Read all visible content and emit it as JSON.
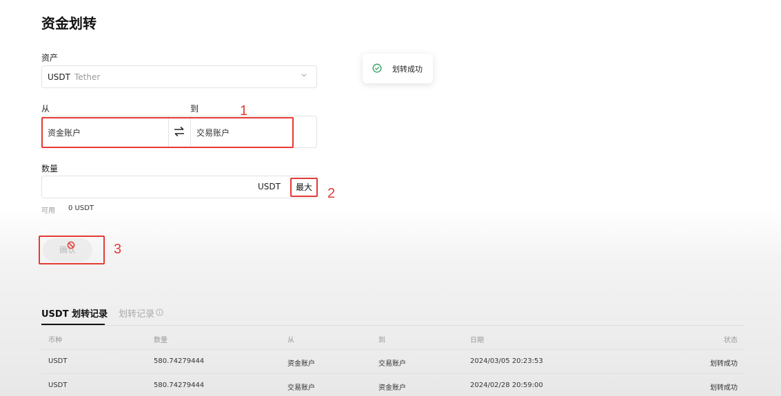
{
  "page": {
    "title": "资金划转"
  },
  "form": {
    "asset_label": "资产",
    "asset_code": "USDT",
    "asset_name": "Tether",
    "from_label": "从",
    "to_label": "到",
    "from_account": "资金账户",
    "to_account": "交易账户",
    "quantity_label": "数量",
    "quantity_unit": "USDT",
    "max_label": "最大",
    "available_label": "可用",
    "available_value": "0 USDT",
    "confirm_label": "确认"
  },
  "annotations": [
    "1",
    "2",
    "3"
  ],
  "toast": {
    "message": "划转成功"
  },
  "records": {
    "tab_active": "USDT 划转记录",
    "tab_inactive": "划转记录",
    "columns": [
      "币种",
      "数量",
      "从",
      "到",
      "日期",
      "状态"
    ],
    "rows": [
      [
        "USDT",
        "580.74279444",
        "资金账户",
        "交易账户",
        "2024/03/05 20:23:53",
        "划转成功"
      ],
      [
        "USDT",
        "580.74279444",
        "交易账户",
        "资金账户",
        "2024/02/28 20:59:00",
        "划转成功"
      ]
    ]
  },
  "colors": {
    "annotation_red": "#e53935",
    "success_green": "#2e9e5b"
  }
}
